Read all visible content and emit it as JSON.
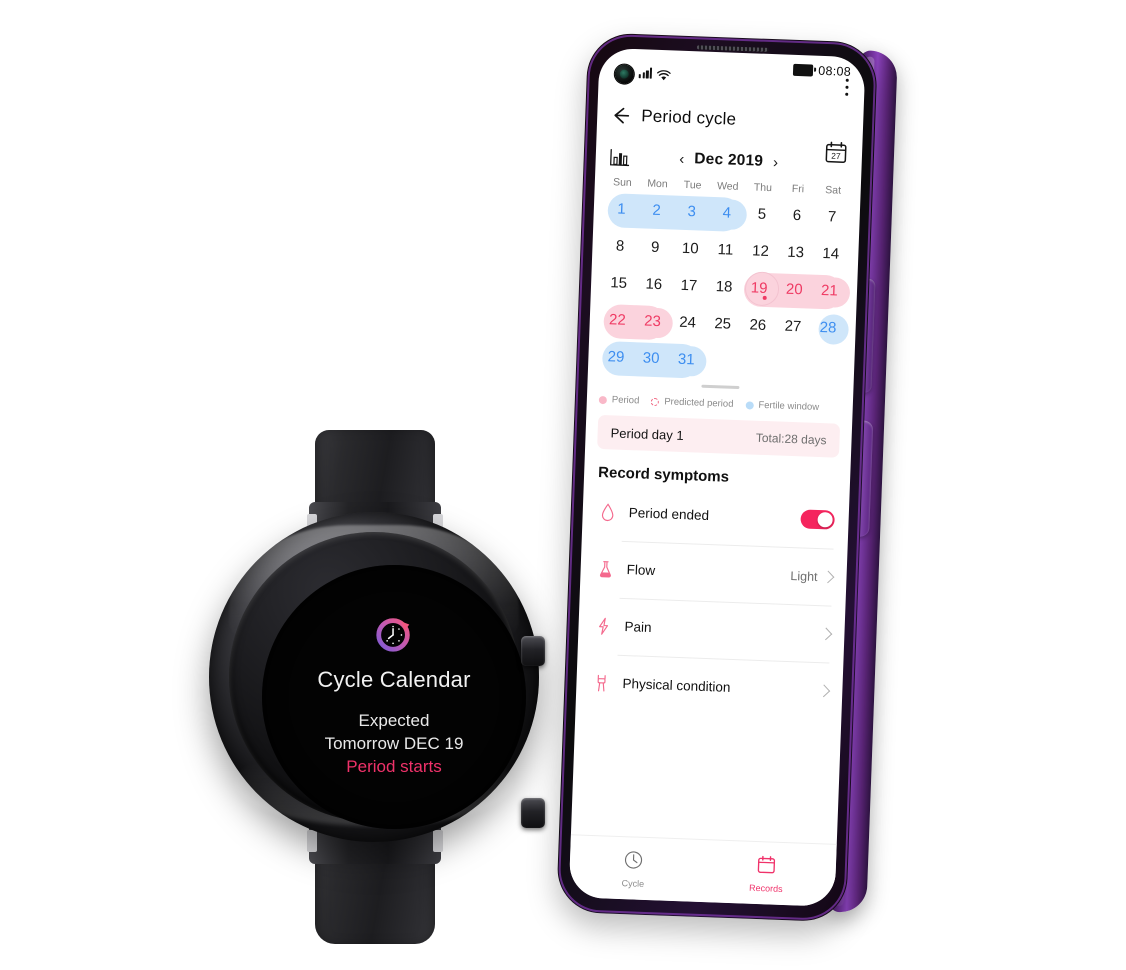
{
  "watch": {
    "app_icon": "cycle-clock-icon",
    "title": "Cycle Calendar",
    "line1": "Expected",
    "line2": "Tomorrow DEC 19",
    "line3": "Period starts",
    "accent_color": "#f0326a"
  },
  "phone": {
    "status_bar": {
      "time": "08:08",
      "battery_icon": "battery-icon",
      "signal_icon": "signal-bars-icon",
      "wifi_icon": "wifi-icon",
      "camera_icon": "front-camera-punch-hole"
    },
    "header": {
      "back_icon": "back-arrow-icon",
      "title": "Period cycle",
      "menu_icon": "more-options-icon"
    },
    "month_bar": {
      "stats_icon": "bar-chart-icon",
      "prev_icon": "chevron-left-icon",
      "label": "Dec 2019",
      "next_icon": "chevron-right-icon",
      "calendar_icon": "calendar-27-icon",
      "calendar_icon_day": "27"
    },
    "calendar": {
      "weekday_headers": [
        "Sun",
        "Mon",
        "Tue",
        "Wed",
        "Thu",
        "Fri",
        "Sat"
      ],
      "weeks": [
        [
          {
            "day": "1",
            "state": "fertile"
          },
          {
            "day": "2",
            "state": "fertile"
          },
          {
            "day": "3",
            "state": "fertile"
          },
          {
            "day": "4",
            "state": "fertile"
          },
          {
            "day": "5",
            "state": "normal"
          },
          {
            "day": "6",
            "state": "normal"
          },
          {
            "day": "7",
            "state": "normal"
          }
        ],
        [
          {
            "day": "8",
            "state": "normal"
          },
          {
            "day": "9",
            "state": "normal"
          },
          {
            "day": "10",
            "state": "normal"
          },
          {
            "day": "11",
            "state": "normal"
          },
          {
            "day": "12",
            "state": "normal"
          },
          {
            "day": "13",
            "state": "normal"
          },
          {
            "day": "14",
            "state": "normal"
          }
        ],
        [
          {
            "day": "15",
            "state": "normal"
          },
          {
            "day": "16",
            "state": "normal"
          },
          {
            "day": "17",
            "state": "normal"
          },
          {
            "day": "18",
            "state": "normal"
          },
          {
            "day": "19",
            "state": "period-today"
          },
          {
            "day": "20",
            "state": "period"
          },
          {
            "day": "21",
            "state": "period"
          }
        ],
        [
          {
            "day": "22",
            "state": "period"
          },
          {
            "day": "23",
            "state": "period"
          },
          {
            "day": "24",
            "state": "normal"
          },
          {
            "day": "25",
            "state": "normal"
          },
          {
            "day": "26",
            "state": "normal"
          },
          {
            "day": "27",
            "state": "normal"
          },
          {
            "day": "28",
            "state": "fertile"
          }
        ],
        [
          {
            "day": "29",
            "state": "fertile"
          },
          {
            "day": "30",
            "state": "fertile"
          },
          {
            "day": "31",
            "state": "fertile"
          },
          {
            "day": "",
            "state": "empty"
          },
          {
            "day": "",
            "state": "empty"
          },
          {
            "day": "",
            "state": "empty"
          },
          {
            "day": "",
            "state": "empty"
          }
        ]
      ]
    },
    "legend": [
      {
        "label": "Period",
        "marker": "solid-pink-dot"
      },
      {
        "label": "Predicted period",
        "marker": "dashed-pink-ring"
      },
      {
        "label": "Fertile window",
        "marker": "solid-blue-dot"
      }
    ],
    "summary_banner": {
      "left": "Period day 1",
      "right": "Total:28 days"
    },
    "symptoms": {
      "section_title": "Record symptoms",
      "items": [
        {
          "label": "Period ended",
          "icon": "droplet-icon",
          "control": "toggle",
          "value": "on",
          "toggle_on": true
        },
        {
          "label": "Flow",
          "icon": "flask-icon",
          "control": "chevron",
          "value": "Light"
        },
        {
          "label": "Pain",
          "icon": "lightning-icon",
          "control": "chevron",
          "value": ""
        },
        {
          "label": "Physical condition",
          "icon": "body-icon",
          "control": "chevron",
          "value": ""
        }
      ]
    },
    "bottom_nav": [
      {
        "label": "Cycle",
        "icon": "clock-icon",
        "active": false
      },
      {
        "label": "Records",
        "icon": "calendar-icon",
        "active": true
      }
    ],
    "colors": {
      "period_fill": "#fbd3dd",
      "period_text": "#ef3b64",
      "fertile_fill": "#cfe6fa",
      "fertile_text": "#3d8ef0",
      "accent": "#f5255e",
      "banner_bg": "#fdeef1",
      "frame": "#8b43bd"
    }
  }
}
